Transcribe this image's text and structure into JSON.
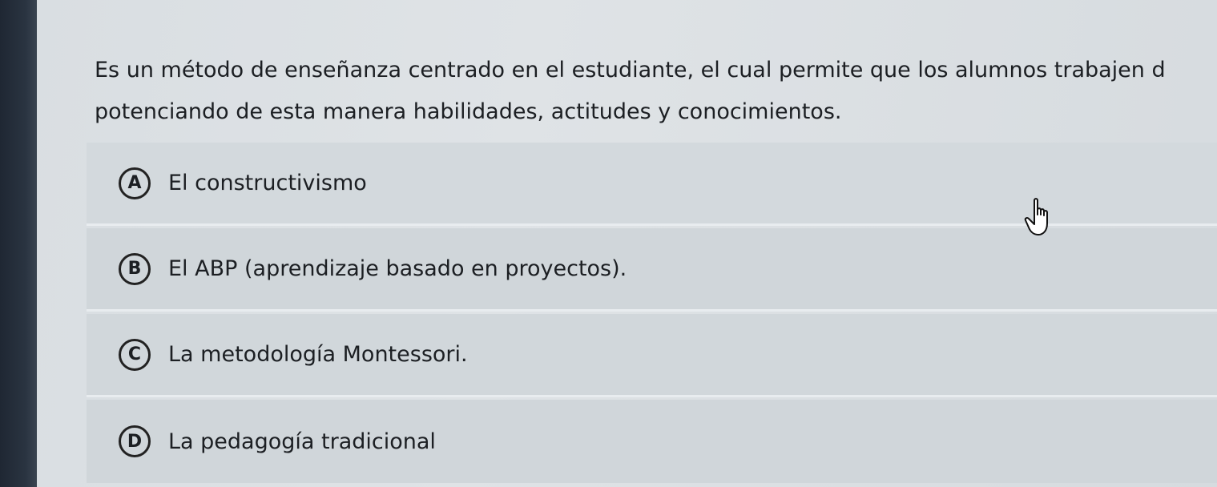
{
  "question": {
    "text": "Es un método de enseñanza centrado en el estudiante, el cual permite que los alumnos trabajen d\npotenciando de esta manera habilidades, actitudes y conocimientos."
  },
  "options": [
    {
      "letter": "A",
      "label": "El constructivismo"
    },
    {
      "letter": "B",
      "label": "El ABP (aprendizaje basado en proyectos)."
    },
    {
      "letter": "C",
      "label": "La metodología Montessori."
    },
    {
      "letter": "D",
      "label": "La pedagogía tradicional"
    }
  ],
  "cursor": {
    "icon": "hand-pointer-icon"
  }
}
